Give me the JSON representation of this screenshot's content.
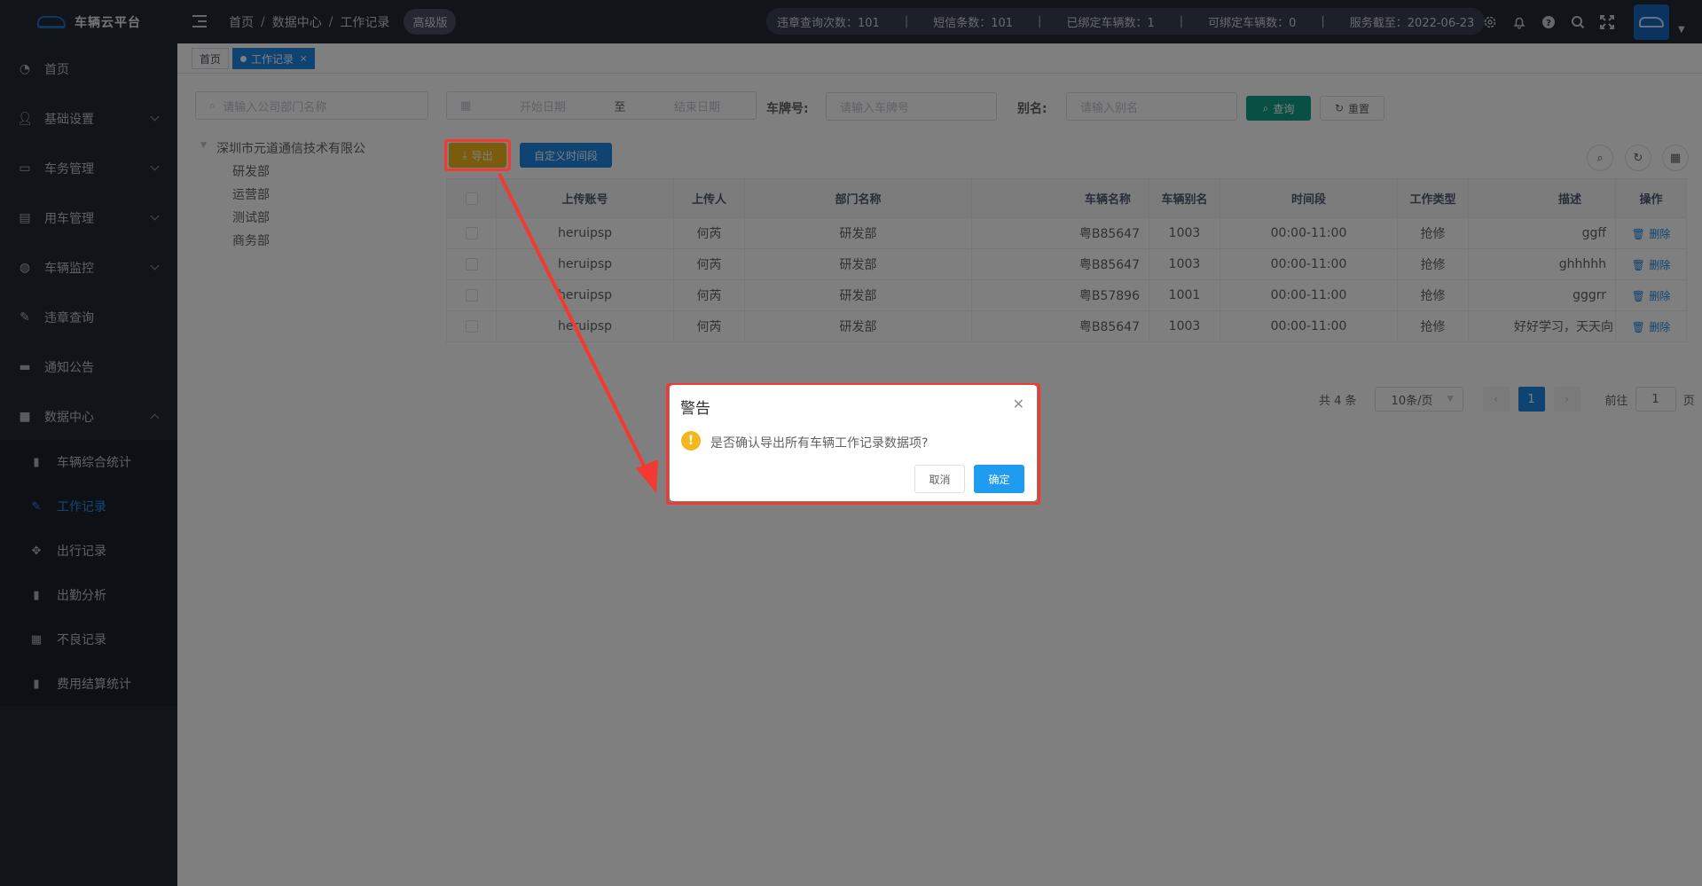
{
  "app": {
    "title": "车辆云平台"
  },
  "breadcrumb": [
    "首页",
    "数据中心",
    "工作记录"
  ],
  "version_badge": "高级版",
  "stats": [
    "违章查询次数：101",
    "短信条数：101",
    "已绑定车辆数：1",
    "可绑定车辆数：0",
    "服务截至：2022-06-23"
  ],
  "sidebar": {
    "items": [
      {
        "label": "首页",
        "icon": "dashboard-icon",
        "expandable": false
      },
      {
        "label": "基础设置",
        "icon": "user-icon",
        "expandable": true
      },
      {
        "label": "车务管理",
        "icon": "monitor-icon",
        "expandable": true
      },
      {
        "label": "用车管理",
        "icon": "document-icon",
        "expandable": true
      },
      {
        "label": "车辆监控",
        "icon": "globe-icon",
        "expandable": true
      },
      {
        "label": "违章查询",
        "icon": "edit-icon",
        "expandable": false
      },
      {
        "label": "通知公告",
        "icon": "message-icon",
        "expandable": false
      },
      {
        "label": "数据中心",
        "icon": "lock-icon",
        "expandable": true,
        "expanded": true
      }
    ],
    "sub_items": [
      {
        "label": "车辆综合统计",
        "icon": "bar-chart-icon"
      },
      {
        "label": "工作记录",
        "icon": "edit-icon",
        "active": true
      },
      {
        "label": "出行记录",
        "icon": "move-icon"
      },
      {
        "label": "出勤分析",
        "icon": "bar-chart-icon"
      },
      {
        "label": "不良记录",
        "icon": "table-icon"
      },
      {
        "label": "费用结算统计",
        "icon": "bar-chart-icon"
      }
    ]
  },
  "tabs": [
    {
      "label": "首页",
      "active": false
    },
    {
      "label": "工作记录",
      "active": true,
      "close": "×"
    }
  ],
  "dept_search": {
    "placeholder": "请输入公司部门名称"
  },
  "tree": {
    "root": "深圳市元道通信技术有限公",
    "children": [
      "研发部",
      "运营部",
      "测试部",
      "商务部"
    ]
  },
  "filters": {
    "start_placeholder": "开始日期",
    "range_sep": "至",
    "end_placeholder": "结束日期",
    "plate_label": "车牌号:",
    "plate_placeholder": "请输入车牌号",
    "alias_label": "别名:",
    "alias_placeholder": "请输入别名",
    "search_button": "查询",
    "reset_button": "重置"
  },
  "toolbar": {
    "export_button": "导出",
    "custom_period_button": "自定义时间段"
  },
  "table": {
    "columns": [
      "上传账号",
      "上传人",
      "部门名称",
      "车辆名称",
      "车辆别名",
      "时间段",
      "工作类型",
      "描述",
      "操作"
    ],
    "delete_label": "删除",
    "rows": [
      [
        "heruipsp",
        "何芮",
        "研发部",
        "粤B85647",
        "1003",
        "00:00-11:00",
        "抢修",
        "ggff"
      ],
      [
        "heruipsp",
        "何芮",
        "研发部",
        "粤B85647",
        "1003",
        "00:00-11:00",
        "抢修",
        "ghhhhh"
      ],
      [
        "heruipsp",
        "何芮",
        "研发部",
        "粤B57896",
        "1001",
        "00:00-11:00",
        "抢修",
        "gggrr"
      ],
      [
        "heruipsp",
        "何芮",
        "研发部",
        "粤B85647",
        "1003",
        "00:00-11:00",
        "抢修",
        "好好学习，天天向"
      ]
    ]
  },
  "pagination": {
    "total": "共 4 条",
    "page_size": "10条/页",
    "current_page": "1",
    "goto_label": "前往",
    "goto_value": "1",
    "page_unit": "页"
  },
  "dialog": {
    "title": "警告",
    "message": "是否确认导出所有车辆工作记录数据项?",
    "cancel": "取消",
    "confirm": "确定"
  },
  "colors": {
    "sidebar_bg": "#222a35",
    "accent": "#1e88e5",
    "search_button": "#13a089",
    "export_button": "#f2b81c",
    "annotation_red": "#f23a32",
    "dialog_confirm": "#1f9bf0"
  }
}
